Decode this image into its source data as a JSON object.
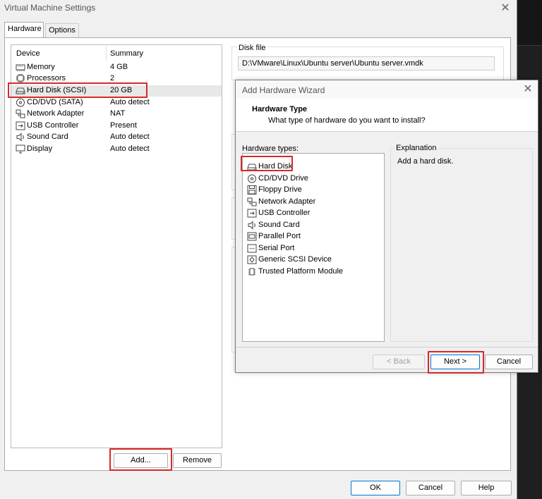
{
  "window": {
    "title": "Virtual Machine Settings",
    "close_glyph": "✕",
    "tabs": [
      {
        "label": "Hardware",
        "active": true
      },
      {
        "label": "Options",
        "active": false
      }
    ]
  },
  "device_list": {
    "headers": {
      "device": "Device",
      "summary": "Summary"
    },
    "rows": [
      {
        "icon": "memory-icon",
        "device": "Memory",
        "summary": "4 GB"
      },
      {
        "icon": "processor-icon",
        "device": "Processors",
        "summary": "2"
      },
      {
        "icon": "hard-disk-icon",
        "device": "Hard Disk (SCSI)",
        "summary": "20 GB",
        "selected": true
      },
      {
        "icon": "cd-dvd-icon",
        "device": "CD/DVD (SATA)",
        "summary": "Auto detect"
      },
      {
        "icon": "network-adapter-icon",
        "device": "Network Adapter",
        "summary": "NAT"
      },
      {
        "icon": "usb-icon",
        "device": "USB Controller",
        "summary": "Present"
      },
      {
        "icon": "sound-card-icon",
        "device": "Sound Card",
        "summary": "Auto detect"
      },
      {
        "icon": "display-icon",
        "device": "Display",
        "summary": "Auto detect"
      }
    ]
  },
  "list_buttons": {
    "add": "Add...",
    "remove": "Remove"
  },
  "disk_file": {
    "label": "Disk file",
    "path": "D:\\VMware\\Linux\\Ubuntu server\\Ubuntu server.vmdk"
  },
  "footer_buttons": {
    "ok": "OK",
    "cancel": "Cancel",
    "help": "Help"
  },
  "wizard": {
    "title": "Add Hardware Wizard",
    "close_glyph": "✕",
    "heading": "Hardware Type",
    "subheading": "What type of hardware do you want to install?",
    "types_label": "Hardware types:",
    "types": [
      {
        "icon": "hard-disk-icon",
        "label": "Hard Disk",
        "selected": true
      },
      {
        "icon": "cd-dvd-icon",
        "label": "CD/DVD Drive"
      },
      {
        "icon": "floppy-icon",
        "label": "Floppy Drive"
      },
      {
        "icon": "network-adapter-icon",
        "label": "Network Adapter"
      },
      {
        "icon": "usb-icon",
        "label": "USB Controller"
      },
      {
        "icon": "sound-card-icon",
        "label": "Sound Card"
      },
      {
        "icon": "parallel-port-icon",
        "label": "Parallel Port"
      },
      {
        "icon": "serial-port-icon",
        "label": "Serial Port"
      },
      {
        "icon": "scsi-device-icon",
        "label": "Generic SCSI Device"
      },
      {
        "icon": "tpm-icon",
        "label": "Trusted Platform Module"
      }
    ],
    "explanation_label": "Explanation",
    "explanation_text": "Add a hard disk.",
    "buttons": {
      "back": "< Back",
      "next": "Next >",
      "cancel": "Cancel"
    }
  },
  "colors": {
    "highlight": "#d62a2a",
    "accent": "#0078d7"
  }
}
